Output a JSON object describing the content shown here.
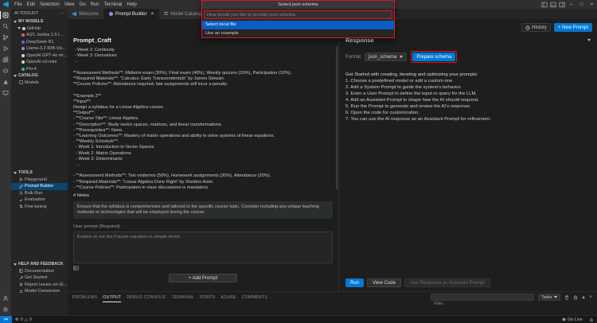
{
  "colors": {
    "accent": "#0078d4",
    "annotation": "#e81123",
    "list_selection": "#0a5dc2",
    "sidebar_selection": "#094771"
  },
  "icons": {
    "minimize": "─",
    "maximize": "□",
    "close": "×",
    "tab_close": "×",
    "more": "···",
    "remote": "><",
    "error": "⊗",
    "warning": "△",
    "go_live_dot": "◉"
  },
  "titlebar": {
    "menus": [
      "File",
      "Edit",
      "Selection",
      "View",
      "Go",
      "Run",
      "Terminal",
      "Help"
    ]
  },
  "quick_input": {
    "title": "Select json schema",
    "input_placeholder": "How would you like to provide json schema",
    "options": [
      {
        "label": "Select local file"
      },
      {
        "label": "Use an example"
      }
    ]
  },
  "tabs": [
    {
      "label": "Welcome"
    },
    {
      "label": "Prompt Builder"
    },
    {
      "label": "Model Catalog"
    }
  ],
  "editor_actions": {
    "history": "History",
    "new_prompt": "+ New Prompt"
  },
  "sidebar": {
    "title": "AI TOOLKIT",
    "my_models": {
      "header": "MY MODELS",
      "group": "GitHub",
      "models": [
        "AI21 Jamba 1.5 L...",
        "DeepSeek-R1",
        "Llama-3.2-90B-Vis...",
        "OpenAI GPT-4o mi...",
        "OpenAI o3-mini",
        "Phi-4"
      ]
    },
    "catalog": {
      "header": "CATALOG",
      "items": [
        "Models"
      ]
    },
    "tools": {
      "header": "TOOLS",
      "items": [
        "Playground",
        "Prompt Builder",
        "Bulk Run",
        "Evaluation",
        "Fine-tuning"
      ],
      "selected": "Prompt Builder"
    },
    "help": {
      "header": "HELP AND FEEDBACK",
      "items": [
        "Documentation",
        "Get Started",
        "Report Issues on Gi...",
        "Model Conversion"
      ]
    }
  },
  "prompt_panel": {
    "title": "Prompt_Craft",
    "system_prompt_text": " - Week 2: Continuity\n - Week 3: Derivatives\n ...\n\n**Assessment Methods**: Midterm exam (30%), Final exam (40%), Weekly quizzes (20%), Participation (10%).\n**Required Materials**: \"Calculus: Early Transcendentals\" by James Stewart.\n**Course Policies**: Attendance required, late assignments will incur a penalty.\n\n**Example 2**\n**Input**:\nDesign a syllabus for a Linear Algebra course.\n**Output**:\n- **Course Title**: Linear Algebra\n- **Description**: Study vector spaces, matrices, and linear transformations.\n- **Prerequisites**: None.\n- **Learning Outcomes**: Mastery of matrix operations and ability to solve systems of linear equations.\n- **Weekly Schedule**:\n  - Week 1: Introduction to Vector Spaces\n  - Week 2: Matrix Operations\n  - Week 3: Determinants\n  ...\n\n- **Assessment Methods**: Two midterms (50%), Homework assignments (30%), Attendance (20%).\n- **Required Materials**: \"Linear Algebra Done Right\" by Sheldon Axler.\n- **Course Policies**: Participation in class discussions is mandatory.",
    "notes_heading": "# Notes",
    "notes_text": "Ensure that the syllabus is comprehensive and tailored to the specific course topic. Consider including any unique teaching methods or technologies that will be employed during the course.",
    "user_prompt_label": "User prompt (Required)",
    "user_prompt_placeholder": "Explain to me the Fourier equation in simple terms",
    "add_prompt_label": "+ Add Prompt"
  },
  "response_panel": {
    "title": "Response",
    "format_label": "Format",
    "format_value": "json_schema",
    "prepare_schema_label": "Prepare schema",
    "get_started_heading": "Get Started with creating, iterating and optimizing your prompts:",
    "steps": [
      "1. Choose a predefined model or add a custom one.",
      "2. Add a System Prompt to guide the system's behavior.",
      "3. Enter a User Prompt to define the input or query for the LLM.",
      "4. Add an Assistant Prompt to shape how the AI should respond.",
      "5. Run the Prompt to generate and review the AI's response.",
      "6. Open the code for customization.",
      "7. You can use the AI response as an Assistant Prompt for refinement."
    ],
    "run_label": "Run",
    "view_code_label": "View Code",
    "use_response_label": "Use Response as Assistant Prompt"
  },
  "panel": {
    "tabs": [
      "PROBLEMS",
      "OUTPUT",
      "DEBUG CONSOLE",
      "TERMINAL",
      "PORTS",
      "AZURE",
      "COMMENTS"
    ],
    "active_tab": "OUTPUT",
    "filter_placeholder": "Filter",
    "tasks_label": "Tasks"
  },
  "statusbar": {
    "errors": "0",
    "warnings": "0",
    "go_live": "Go Live"
  }
}
